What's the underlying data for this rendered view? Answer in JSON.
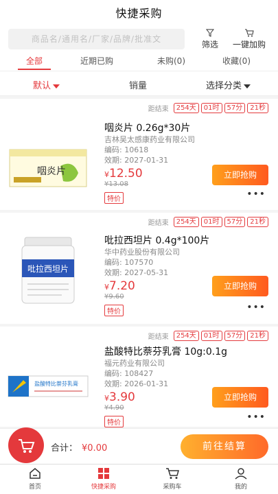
{
  "header": {
    "title": "快捷采购"
  },
  "search": {
    "placeholder": "商品名/通用名/厂家/品牌/批准文"
  },
  "tools": {
    "filter": "筛选",
    "onekey": "一键加购"
  },
  "tabs": [
    "全部",
    "近期已购",
    "未购(0)",
    "收藏(0)"
  ],
  "sort": {
    "default": "默认",
    "sales": "销量",
    "category": "选择分类"
  },
  "countdown": {
    "label": "距结束",
    "days": "254天",
    "hours": "01时",
    "minutes": "57分",
    "seconds": "21秒"
  },
  "products": [
    {
      "name": "咽炎片 0.26g*30片",
      "maker": "吉林吴太感康药业有限公司",
      "code": "编码: 10618",
      "expiry": "效期: 2027-01-31",
      "price_symbol": "¥",
      "price": "12.50",
      "old_price": "¥13.08",
      "tag": "特价",
      "buy": "立即抢购",
      "img_text": "咽炎片"
    },
    {
      "name": "吡拉西坦片 0.4g*100片",
      "maker": "华中药业股份有限公司",
      "code": "编码: 107570",
      "expiry": "效期: 2027-05-31",
      "price_symbol": "¥",
      "price": "7.20",
      "old_price": "¥9.60",
      "tag": "特价",
      "buy": "立即抢购",
      "img_text": "吡拉西坦片"
    },
    {
      "name": "盐酸特比萘芬乳膏 10g:0.1g",
      "maker": "福元药业有限公司",
      "code": "编码: 108427",
      "expiry": "效期: 2026-01-31",
      "price_symbol": "¥",
      "price": "3.90",
      "old_price": "¥4.90",
      "tag": "特价",
      "buy": "立即抢购",
      "img_text": "盐酸特比萘芬乳膏"
    }
  ],
  "checkout": {
    "total_label": "合计：",
    "total": "¥0.00",
    "button": "前往结算"
  },
  "tabbar": [
    "首页",
    "快捷采购",
    "采购车",
    "我的"
  ],
  "colors": {
    "accent": "#e4393c",
    "button_gradient": "#ff9f1c"
  }
}
